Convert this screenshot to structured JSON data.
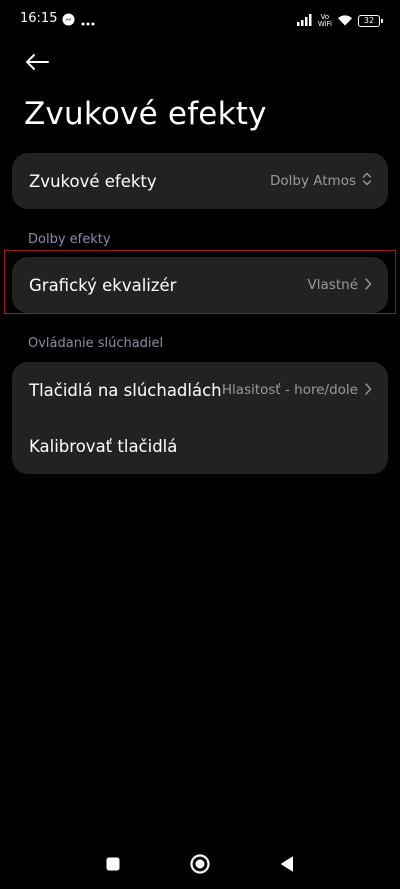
{
  "status_bar": {
    "time": "16:15",
    "left_icons": [
      "messenger-icon",
      "more-dots-icon"
    ],
    "volte_line1": "Vo",
    "volte_line2": "WiFi",
    "battery": "32"
  },
  "header": {
    "title": "Zvukové efekty"
  },
  "main_card": {
    "label": "Zvukové efekty",
    "value": "Dolby Atmos"
  },
  "dolby_section": {
    "header": "Dolby efekty",
    "label": "Grafický ekvalizér",
    "value": "Vlastné"
  },
  "headphone_section": {
    "header": "Ovládanie slúchadiel",
    "items": [
      {
        "label": "Tlačidlá na slúchadlách",
        "value": "Hlasitosť - hore/dole"
      },
      {
        "label": "Kalibrovať tlačidlá"
      }
    ]
  },
  "colors": {
    "background": "#000000",
    "card": "#222222",
    "section_header": "#8c8ca8",
    "value_text": "#9a9a9a",
    "highlight": "#a01818"
  }
}
